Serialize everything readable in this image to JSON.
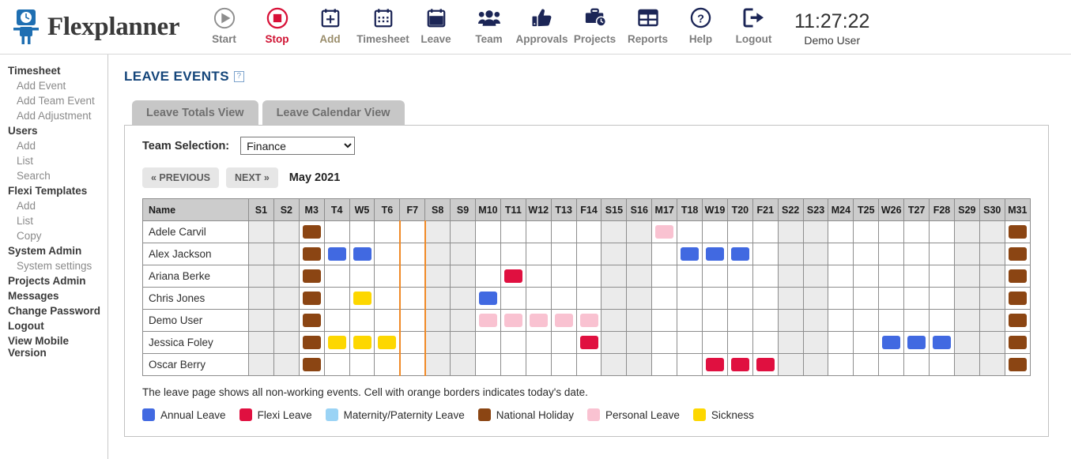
{
  "app": {
    "brand": "Flexplanner",
    "logo_icon": "clock-person-logo-icon"
  },
  "toolbar": {
    "items": [
      {
        "label": "Start",
        "icon": "play-circle-icon",
        "color": "#7d7d7d"
      },
      {
        "label": "Stop",
        "icon": "stop-circle-icon",
        "color": "#cf1131"
      },
      {
        "label": "Add",
        "icon": "calendar-plus-icon",
        "color": "#9a8d6b"
      },
      {
        "label": "Timesheet",
        "icon": "calendar-grid-icon",
        "color": "#7d7d7d"
      },
      {
        "label": "Leave",
        "icon": "calendar-solid-icon",
        "color": "#7d7d7d"
      },
      {
        "label": "Team",
        "icon": "people-group-icon",
        "color": "#7d7d7d"
      },
      {
        "label": "Approvals",
        "icon": "thumbs-up-icon",
        "color": "#7d7d7d"
      },
      {
        "label": "Projects",
        "icon": "briefcase-clock-icon",
        "color": "#7d7d7d"
      },
      {
        "label": "Reports",
        "icon": "table-grid-icon",
        "color": "#7d7d7d"
      },
      {
        "label": "Help",
        "icon": "question-circle-icon",
        "color": "#7d7d7d"
      },
      {
        "label": "Logout",
        "icon": "sign-out-icon",
        "color": "#7d7d7d"
      }
    ],
    "clock_time": "11:27:22",
    "clock_user": "Demo User"
  },
  "sidebar": {
    "items": [
      {
        "label": "Timesheet",
        "type": "head"
      },
      {
        "label": "Add Event",
        "type": "sub"
      },
      {
        "label": "Add Team Event",
        "type": "sub"
      },
      {
        "label": "Add Adjustment",
        "type": "sub"
      },
      {
        "label": "Users",
        "type": "head"
      },
      {
        "label": "Add",
        "type": "sub"
      },
      {
        "label": "List",
        "type": "sub"
      },
      {
        "label": "Search",
        "type": "sub"
      },
      {
        "label": "Flexi Templates",
        "type": "head"
      },
      {
        "label": "Add",
        "type": "sub"
      },
      {
        "label": "List",
        "type": "sub"
      },
      {
        "label": "Copy",
        "type": "sub"
      },
      {
        "label": "System Admin",
        "type": "head"
      },
      {
        "label": "System settings",
        "type": "sub"
      },
      {
        "label": "Projects Admin",
        "type": "head"
      },
      {
        "label": "Messages",
        "type": "head"
      },
      {
        "label": "Change Password",
        "type": "head"
      },
      {
        "label": "Logout",
        "type": "head"
      },
      {
        "label": "View Mobile Version",
        "type": "head"
      }
    ]
  },
  "page": {
    "title": "LEAVE EVENTS",
    "help_glyph": "?",
    "tabs": [
      {
        "label": "Leave Totals View",
        "active": true
      },
      {
        "label": "Leave Calendar View",
        "active": false
      }
    ]
  },
  "controls": {
    "team_label": "Team Selection:",
    "team_value": "Finance",
    "team_options": [
      "Finance"
    ],
    "prev_label": "« PREVIOUS",
    "next_label": "NEXT »",
    "month_label": "May 2021"
  },
  "calendar": {
    "name_header": "Name",
    "today_column": "F7",
    "columns": [
      {
        "label": "S1",
        "weekend": true
      },
      {
        "label": "S2",
        "weekend": true
      },
      {
        "label": "M3",
        "weekend": false
      },
      {
        "label": "T4",
        "weekend": false
      },
      {
        "label": "W5",
        "weekend": false
      },
      {
        "label": "T6",
        "weekend": false
      },
      {
        "label": "F7",
        "weekend": false
      },
      {
        "label": "S8",
        "weekend": true
      },
      {
        "label": "S9",
        "weekend": true
      },
      {
        "label": "M10",
        "weekend": false
      },
      {
        "label": "T11",
        "weekend": false
      },
      {
        "label": "W12",
        "weekend": false
      },
      {
        "label": "T13",
        "weekend": false
      },
      {
        "label": "F14",
        "weekend": false
      },
      {
        "label": "S15",
        "weekend": true
      },
      {
        "label": "S16",
        "weekend": true
      },
      {
        "label": "M17",
        "weekend": false
      },
      {
        "label": "T18",
        "weekend": false
      },
      {
        "label": "W19",
        "weekend": false
      },
      {
        "label": "T20",
        "weekend": false
      },
      {
        "label": "F21",
        "weekend": false
      },
      {
        "label": "S22",
        "weekend": true
      },
      {
        "label": "S23",
        "weekend": true
      },
      {
        "label": "M24",
        "weekend": false
      },
      {
        "label": "T25",
        "weekend": false
      },
      {
        "label": "W26",
        "weekend": false
      },
      {
        "label": "T27",
        "weekend": false
      },
      {
        "label": "F28",
        "weekend": false
      },
      {
        "label": "S29",
        "weekend": true
      },
      {
        "label": "S30",
        "weekend": true
      },
      {
        "label": "M31",
        "weekend": false
      }
    ],
    "rows": [
      {
        "name": "Adele Carvil",
        "events": {
          "M3": "national",
          "M17": "personal",
          "M31": "national"
        }
      },
      {
        "name": "Alex Jackson",
        "events": {
          "M3": "national",
          "T4": "annual",
          "W5": "annual",
          "T18": "annual",
          "W19": "annual",
          "T20": "annual",
          "M31": "national"
        }
      },
      {
        "name": "Ariana Berke",
        "events": {
          "M3": "national",
          "T11": "flexi",
          "M31": "national"
        }
      },
      {
        "name": "Chris Jones",
        "events": {
          "M3": "national",
          "W5": "sickness",
          "M10": "annual",
          "M31": "national"
        }
      },
      {
        "name": "Demo User",
        "events": {
          "M3": "national",
          "M10": "personal",
          "T11": "personal",
          "W12": "personal",
          "T13": "personal",
          "F14": "personal",
          "M31": "national"
        }
      },
      {
        "name": "Jessica Foley",
        "events": {
          "M3": "national",
          "T4": "sickness",
          "W5": "sickness",
          "T6": "sickness",
          "F14": "flexi",
          "W26": "annual",
          "T27": "annual",
          "F28": "annual",
          "M31": "national"
        }
      },
      {
        "name": "Oscar Berry",
        "events": {
          "M3": "national",
          "W19": "flexi",
          "T20": "flexi",
          "F21": "flexi",
          "M31": "national"
        }
      }
    ]
  },
  "footer": {
    "note": "The leave page shows all non-working events. Cell with orange borders indicates today's date.",
    "legend": [
      {
        "label": "Annual Leave",
        "key": "annual",
        "color": "#4169e1"
      },
      {
        "label": "Flexi Leave",
        "key": "flexi",
        "color": "#e01040"
      },
      {
        "label": "Maternity/Paternity Leave",
        "key": "maternity",
        "color": "#9ad3f5"
      },
      {
        "label": "National Holiday",
        "key": "national",
        "color": "#8b4513"
      },
      {
        "label": "Personal Leave",
        "key": "personal",
        "color": "#f9c2d1"
      },
      {
        "label": "Sickness",
        "key": "sickness",
        "color": "#fdd700"
      }
    ]
  },
  "colors": {
    "annual": "#4169e1",
    "flexi": "#e01040",
    "maternity": "#9ad3f5",
    "national": "#8b4513",
    "personal": "#f9c2d1",
    "sickness": "#fdd700",
    "today_border": "#f08a27",
    "brand_navy": "#1b2556",
    "title_blue": "#14457a"
  }
}
